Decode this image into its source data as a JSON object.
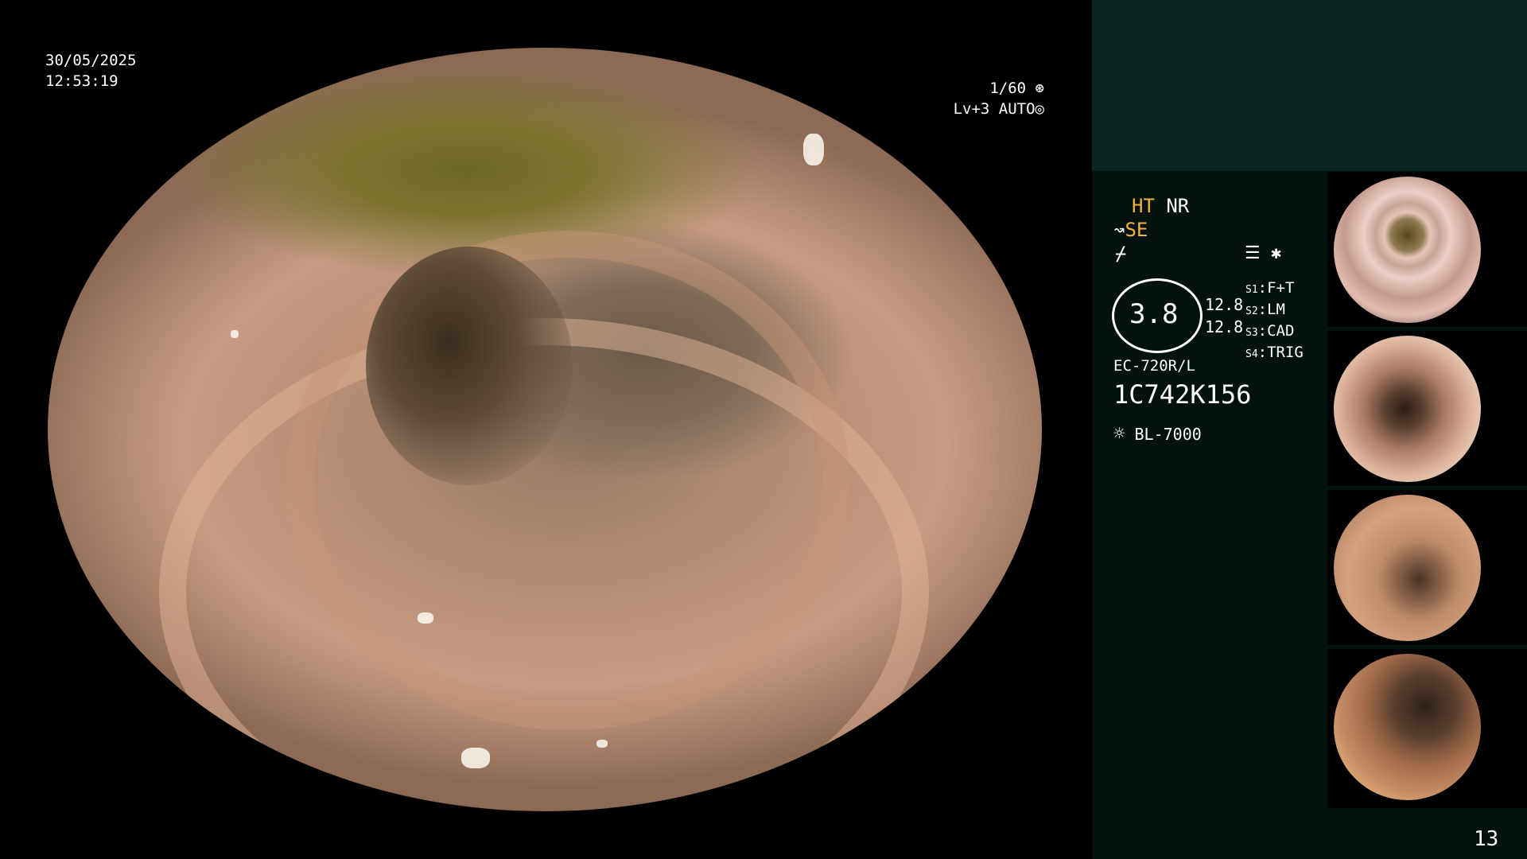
{
  "osd": {
    "date": "30/05/2025",
    "time": "12:53:19",
    "shutter": "1/60",
    "shutter_icon": "⊛",
    "level": "Lv+3",
    "exposure_mode": "AUTO",
    "exposure_icon": "◎"
  },
  "panel": {
    "mode_ht": "HT",
    "mode_nr": "NR",
    "se_icon": "↝",
    "se_label": "SE",
    "flash_icon": "⌿",
    "menu_icon": "☰",
    "asterisk": "✱",
    "gauge_value": "3.8",
    "gauge_right_1": "12.8",
    "gauge_right_2": "12.8",
    "switches": [
      {
        "key": "S1",
        "value": "F+T"
      },
      {
        "key": "S2",
        "value": "LM"
      },
      {
        "key": "S3",
        "value": "CAD"
      },
      {
        "key": "S4",
        "value": "TRIG"
      }
    ],
    "scope_model": "EC-720R/L",
    "serial": "1C742K156",
    "light_icon": "☼",
    "light_source": "BL-7000",
    "capture_count": "13"
  },
  "colors": {
    "accent_amber": "#f2b23c",
    "panel_bg": "#02120f",
    "panel_header": "#0a2724"
  }
}
